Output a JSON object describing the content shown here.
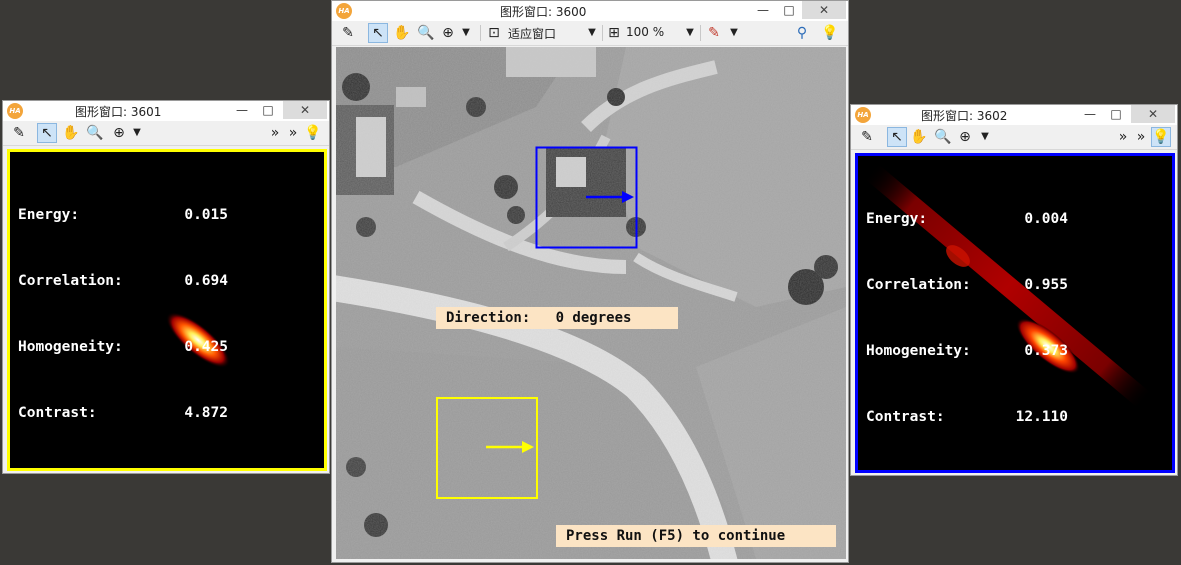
{
  "window_left": {
    "title": "图形窗口: 3601",
    "controls": [
      "—",
      "□",
      "✕"
    ],
    "stats": [
      {
        "label": "Energy:",
        "value": "0.015"
      },
      {
        "label": "Correlation:",
        "value": "0.694"
      },
      {
        "label": "Homogeneity:",
        "value": "0.425"
      },
      {
        "label": "Contrast:",
        "value": "4.872"
      }
    ],
    "frame_color": "#ffff00",
    "overflow_glyph": "»"
  },
  "window_center": {
    "title": "图形窗口: 3600",
    "controls": [
      "—",
      "□",
      "✕"
    ],
    "fit_label": "适应窗口",
    "zoom_label": "100 %",
    "direction_label": "Direction:   0 degrees",
    "continue_label": "Press Run (F5) to continue",
    "blue_box_color": "#0000ff",
    "yellow_box_color": "#ffff00"
  },
  "window_right": {
    "title": "图形窗口: 3602",
    "controls": [
      "—",
      "□",
      "✕"
    ],
    "stats": [
      {
        "label": "Energy:",
        "value": "0.004"
      },
      {
        "label": "Correlation:",
        "value": "0.955"
      },
      {
        "label": "Homogeneity:",
        "value": "0.373"
      },
      {
        "label": "Contrast:",
        "value": "12.110"
      }
    ],
    "frame_color": "#0000ff",
    "overflow_glyph": "»"
  },
  "logo_text": "HA",
  "icons": {
    "edit": "edit-icon",
    "pointer": "pointer-icon",
    "hand": "hand-icon",
    "magnify": "magnify-icon",
    "zoom_plus": "zoom-plus-icon",
    "dropdown": "chevron-down-icon",
    "fit": "fit-window-icon",
    "zoom_level": "zoom-level-icon",
    "color": "color-palette-icon",
    "feature": "feature-inspect-icon",
    "bulb": "lightbulb-icon"
  }
}
